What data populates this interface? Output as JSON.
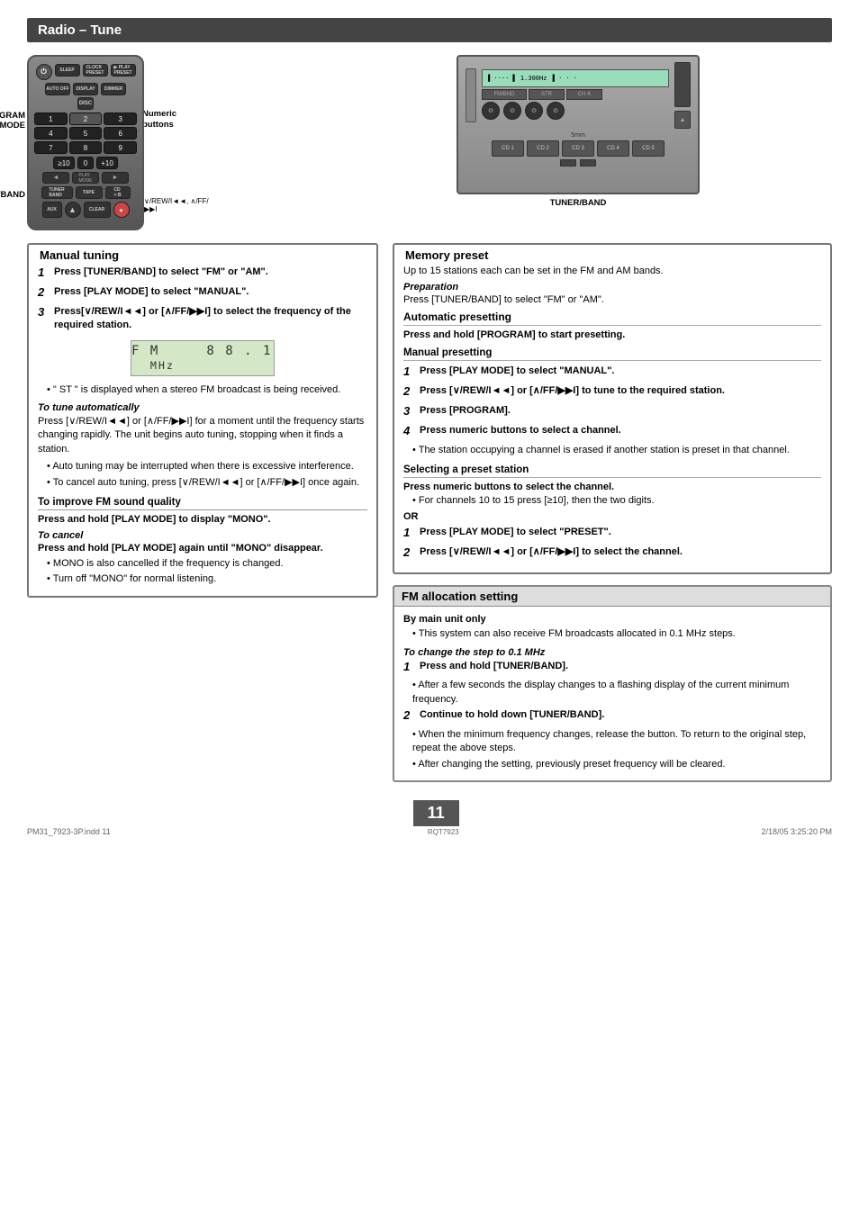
{
  "page": {
    "title": "Radio – Tune",
    "page_number": "11",
    "page_code": "RQT7923",
    "footer_left": "PM31_7923-3P.indd  11",
    "footer_right": "2/18/05  3:25:20 PM"
  },
  "labels": {
    "rogram": "ROGRAM",
    "play_mode": "PLAY MODE",
    "numeric_buttons": "Numeric\nbuttons",
    "tuner_band": "TUNER/BAND",
    "vrew": "∨/REW/I◄◄, ∧/FF/▶▶I",
    "tuner_band_unit": "TUNER/BAND"
  },
  "manual_tuning": {
    "title": "Manual tuning",
    "steps": [
      {
        "num": "1",
        "text": "Press [TUNER/BAND] to select \"FM\" or \"AM\"."
      },
      {
        "num": "2",
        "text": "Press [PLAY MODE] to select \"MANUAL\"."
      },
      {
        "num": "3",
        "text": "Press[∨/REW/I◄◄] or [∧/FF/▶▶I] to select the frequency of the required station."
      }
    ],
    "fm_display": "F M    8 8 . 1   MHz",
    "fm_display_note": "\" ST \" is displayed when a stereo FM broadcast is being received.",
    "auto_tune_heading": "To tune automatically",
    "auto_tune_text": "Press [∨/REW/I◄◄] or [∧/FF/▶▶I] for a moment until the frequency starts changing rapidly. The unit begins auto tuning, stopping when it finds a station.",
    "auto_tune_bullets": [
      "Auto tuning may be interrupted when there is excessive interference.",
      "To cancel auto tuning, press [∨/REW/I◄◄] or [∧/FF/▶▶I] once again."
    ],
    "improve_fm_title": "To improve FM sound quality",
    "improve_fm_text": "Press and hold [PLAY MODE] to display \"MONO\".",
    "to_cancel_heading": "To cancel",
    "to_cancel_text": "Press and hold [PLAY MODE] again until \"MONO\" disappear.",
    "to_cancel_bullets": [
      "MONO is also cancelled if the frequency is changed.",
      "Turn off \"MONO\" for normal listening."
    ]
  },
  "memory_preset": {
    "title": "Memory preset",
    "intro": "Up to 15 stations each can be set in the FM and AM bands.",
    "prep_heading": "Preparation",
    "prep_text": "Press [TUNER/BAND] to select \"FM\" or \"AM\".",
    "auto_presetting_title": "Automatic presetting",
    "auto_presetting_text": "Press and hold [PROGRAM] to start presetting.",
    "manual_presetting_title": "Manual presetting",
    "manual_steps": [
      {
        "num": "1",
        "text": "Press [PLAY MODE] to select \"MANUAL\"."
      },
      {
        "num": "2",
        "text": "Press [∨/REW/I◄◄] or [∧/FF/▶▶I] to tune to the required station."
      },
      {
        "num": "3",
        "text": "Press [PROGRAM]."
      },
      {
        "num": "4",
        "text": "Press numeric buttons to select a channel."
      }
    ],
    "manual_step4_bullet": "The station occupying a channel is erased if another station is preset in that channel.",
    "selecting_title": "Selecting a preset station",
    "selecting_text": "Press numeric buttons to select the channel.",
    "selecting_bullet": "For channels 10 to 15 press [≥10], then the two digits.",
    "or_text": "OR",
    "select_steps": [
      {
        "num": "1",
        "text": "Press [PLAY MODE] to select \"PRESET\"."
      },
      {
        "num": "2",
        "text": "Press [∨/REW/I◄◄] or [∧/FF/▶▶I] to select the channel."
      }
    ]
  },
  "fm_allocation": {
    "title": "FM allocation setting",
    "by_main_unit": "By main unit only",
    "intro_bullet": "This system can also receive FM broadcasts allocated in 0.1 MHz steps.",
    "change_step_heading": "To change the step to 0.1 MHz",
    "steps": [
      {
        "num": "1",
        "text": "Press and hold [TUNER/BAND]."
      },
      {
        "num": "2",
        "text": "Continue to hold down [TUNER/BAND]."
      }
    ],
    "step1_bullet": "After a few seconds the display changes to a flashing display of the current minimum frequency.",
    "step2_bullets": [
      "When the minimum frequency changes, release the button. To return to the original step, repeat the above steps.",
      "After changing the setting, previously preset frequency will be cleared."
    ]
  }
}
